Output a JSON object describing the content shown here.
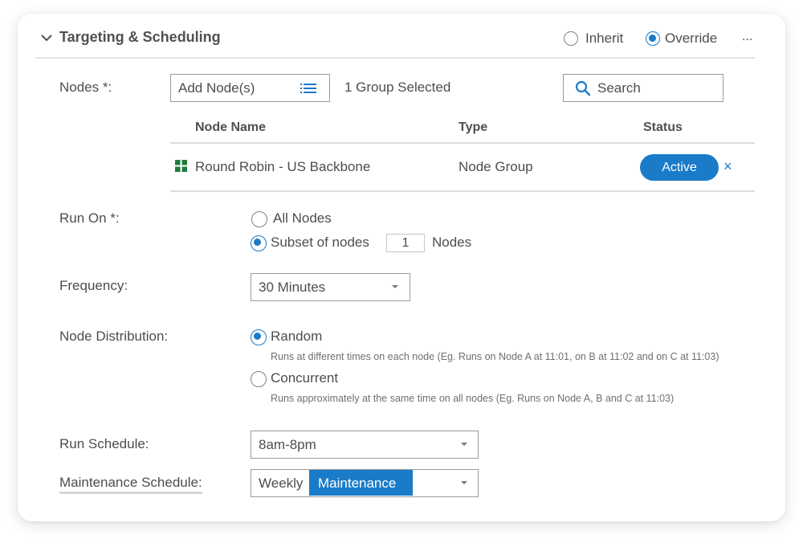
{
  "section": {
    "title": "Targeting & Scheduling",
    "mode_options": [
      {
        "label": "Inherit",
        "checked": false
      },
      {
        "label": "Override",
        "checked": true
      }
    ],
    "more_label": "..."
  },
  "nodes": {
    "label": "Nodes *:",
    "add_button_label": "Add Node(s)",
    "selection_summary": "1 Group Selected",
    "search_placeholder": "Search",
    "table": {
      "columns": [
        "Node Name",
        "Type",
        "Status"
      ],
      "rows": [
        {
          "name": "Round Robin - US Backbone",
          "type": "Node Group",
          "status": "Active",
          "remove": "×"
        }
      ]
    }
  },
  "run_on": {
    "label": "Run On *:",
    "options": [
      {
        "label": "All Nodes",
        "checked": false
      },
      {
        "label": "Subset of nodes",
        "checked": true
      }
    ],
    "subset_count": "1",
    "subset_suffix": "Nodes"
  },
  "frequency": {
    "label": "Frequency:",
    "value": "30 Minutes"
  },
  "distribution": {
    "label": "Node Distribution:",
    "options": [
      {
        "label": "Random",
        "checked": true,
        "hint": "Runs at different times on each node (Eg. Runs on Node A at 11:01, on B at 11:02 and on C at 11:03)"
      },
      {
        "label": "Concurrent",
        "checked": false,
        "hint": "Runs approximately at the same time on all nodes (Eg. Runs on Node A, B and C at 11:03)"
      }
    ]
  },
  "run_schedule": {
    "label": "Run Schedule:",
    "value": "8am-8pm"
  },
  "maintenance_schedule": {
    "label": "Maintenance Schedule:",
    "typed": "Weekly",
    "highlighted": "Maintenance"
  },
  "colors": {
    "accent": "#1a7bc9",
    "group_icon": "#1f7a3c"
  }
}
